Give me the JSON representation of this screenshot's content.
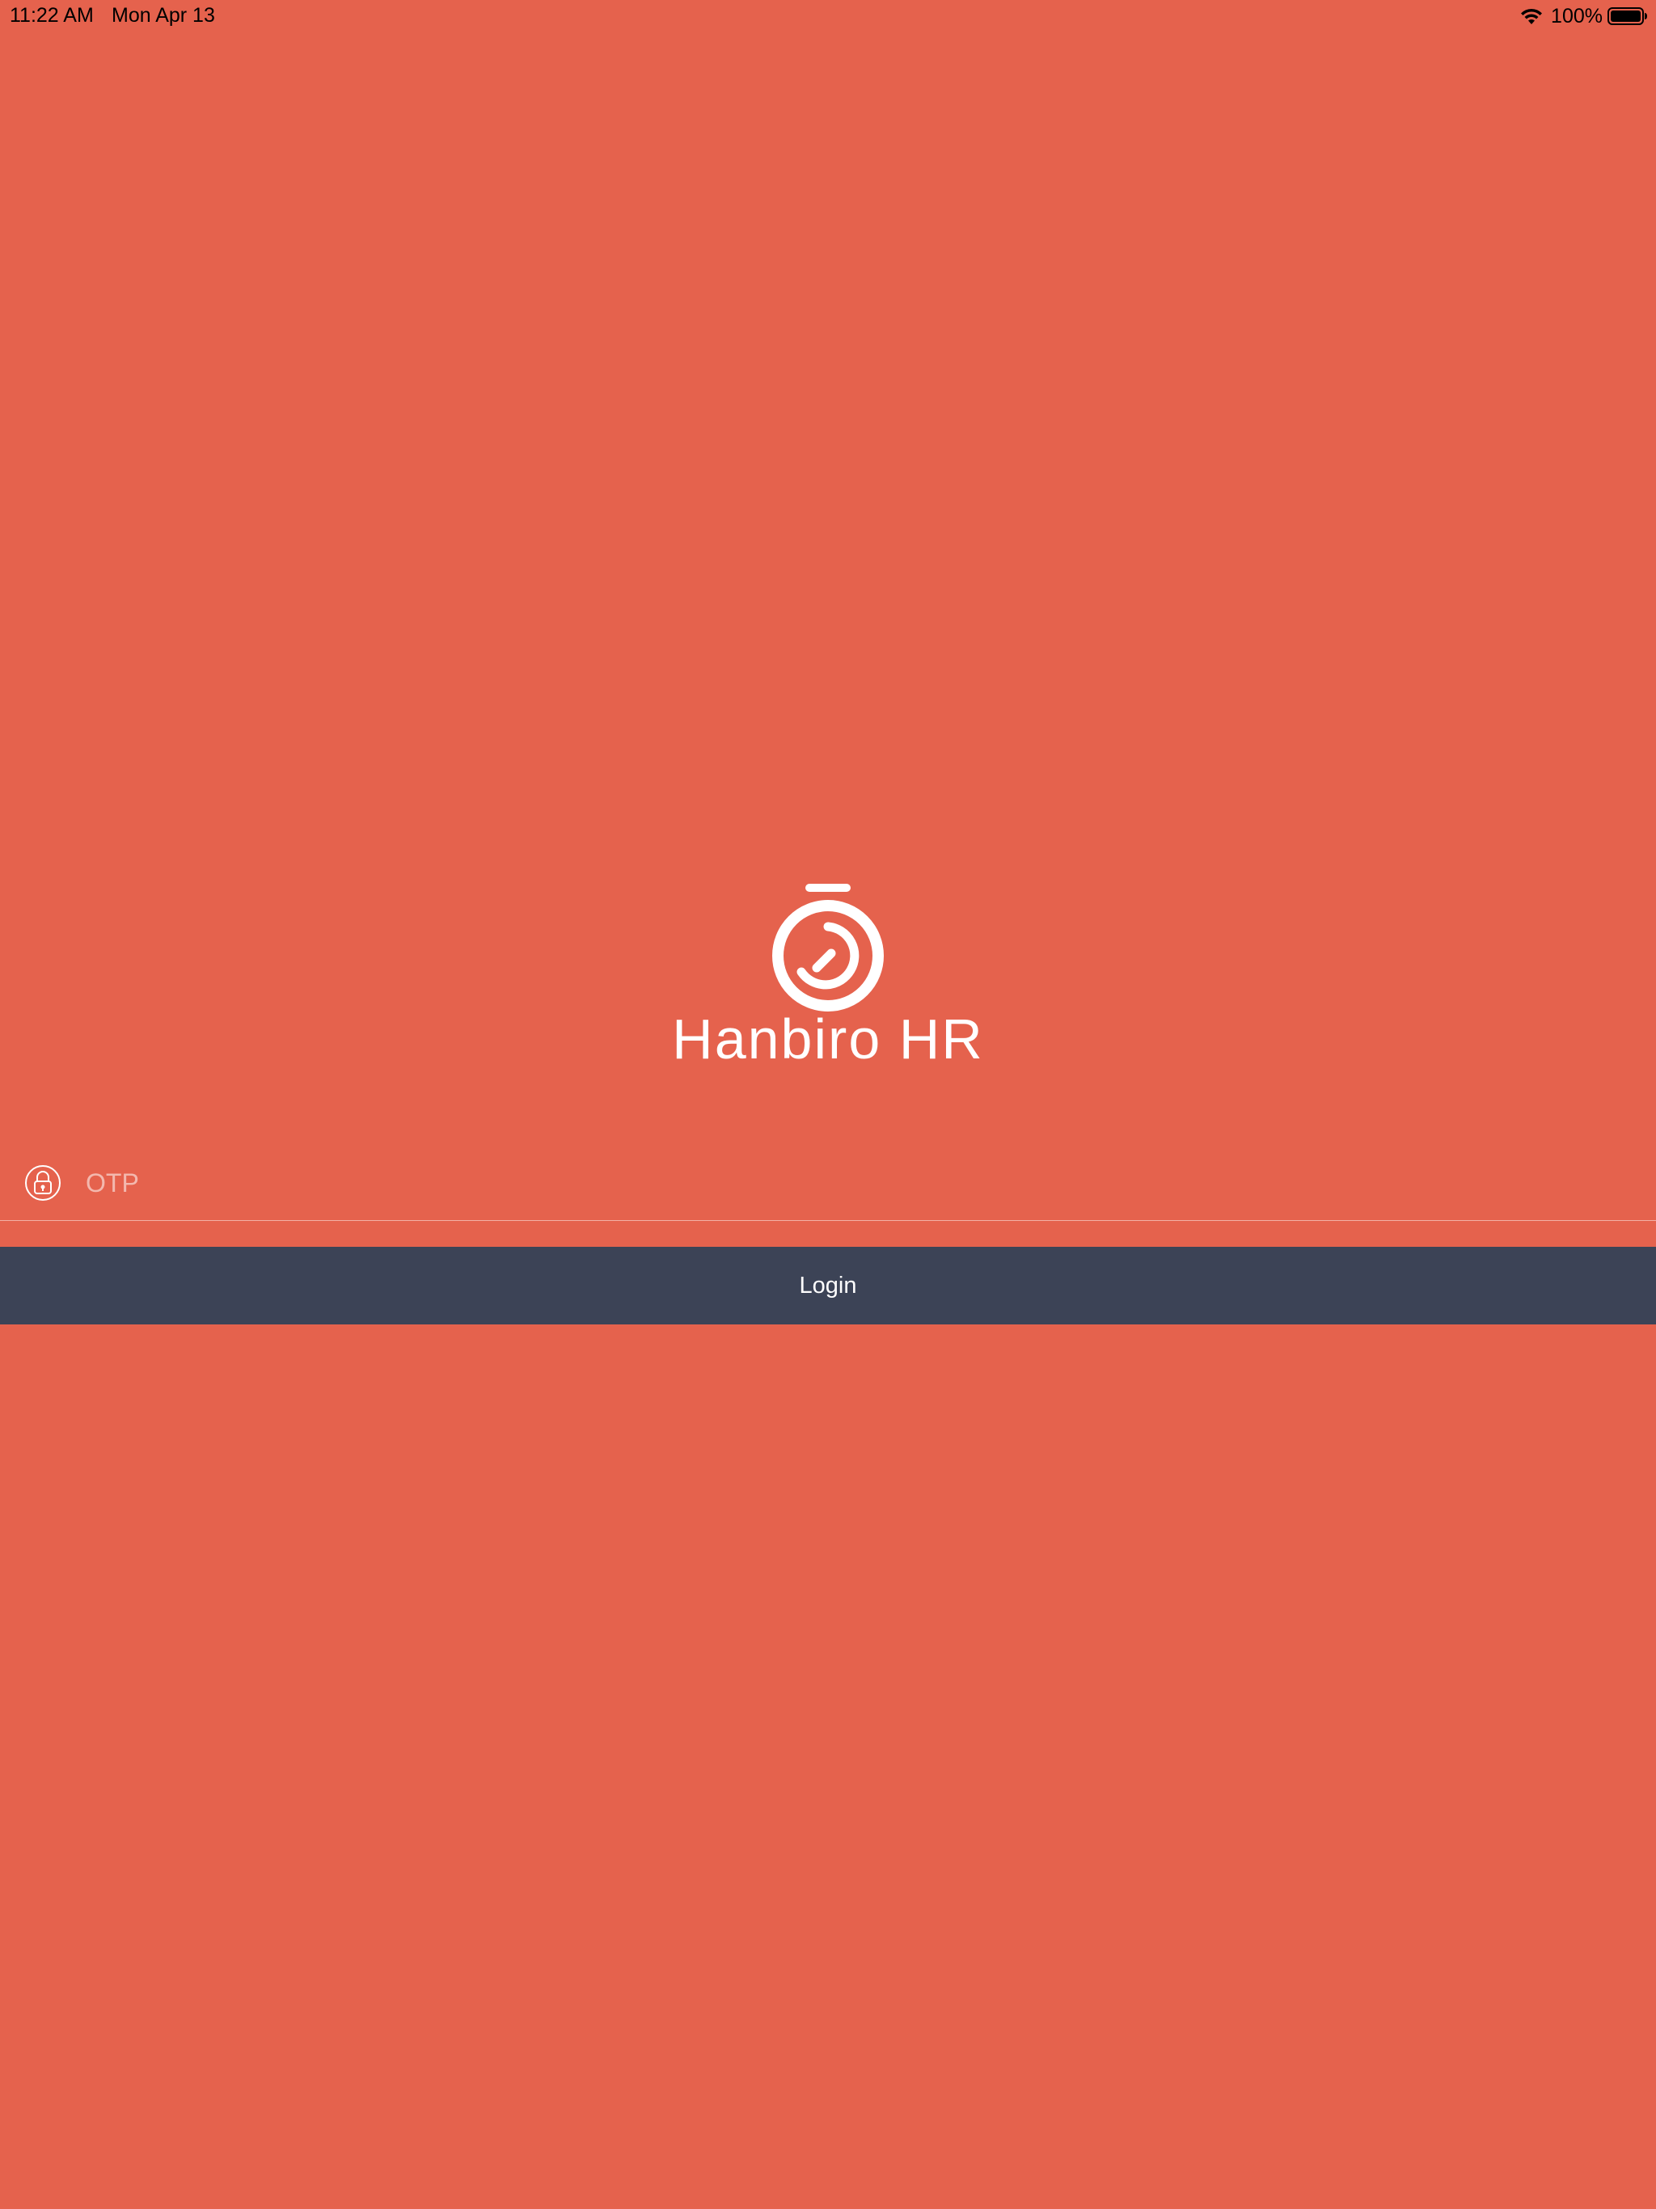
{
  "status_bar": {
    "time": "11:22 AM",
    "date": "Mon Apr 13",
    "battery_text": "100%",
    "battery_level": 1.0,
    "wifi_icon": "wifi-icon",
    "battery_icon": "battery-icon"
  },
  "app": {
    "title": "Hanbiro HR",
    "logo_icon": "stopwatch-logo-icon"
  },
  "otp": {
    "placeholder": "OTP",
    "value": "",
    "icon": "lock-icon"
  },
  "login": {
    "label": "Login"
  },
  "colors": {
    "background": "#E5624D",
    "button": "#3C4356",
    "text": "#FFFFFF"
  }
}
